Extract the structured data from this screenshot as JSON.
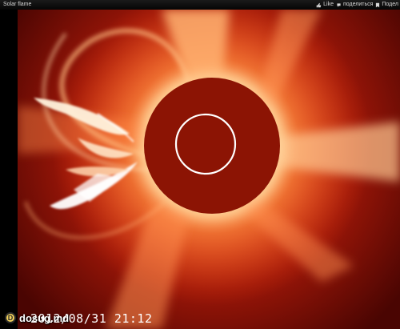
{
  "window": {
    "title": "Solar flame"
  },
  "toolbar": {
    "like_label": "Like",
    "share_label": "поделиться",
    "more_label": "Подел"
  },
  "image": {
    "timestamp": "2012/08/31 21:12",
    "watermark": "dosug.md",
    "watermark_badge": "D"
  },
  "colors": {
    "background": "#000000",
    "occulter_disk": "#8c1404",
    "corona_glow": "#ffb060",
    "sun_outline": "#ffffff"
  }
}
